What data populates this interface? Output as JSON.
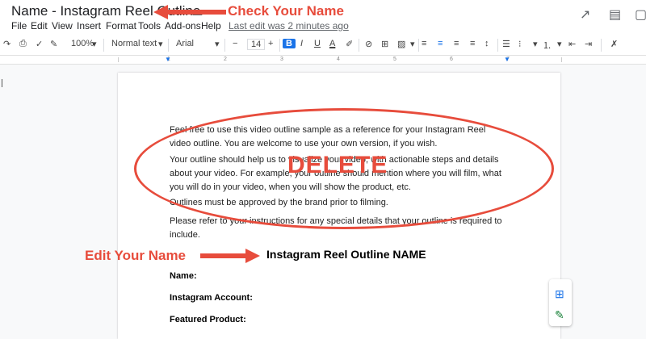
{
  "window": {
    "doc_title": "Name - Instagram Reel Outline",
    "last_edit": "Last edit was 2 minutes ago"
  },
  "menu": [
    "File",
    "Edit",
    "View",
    "Insert",
    "Format",
    "Tools",
    "Add-ons",
    "Help"
  ],
  "toolbar": {
    "zoom": "100%",
    "style": "Normal text",
    "font": "Arial",
    "font_size": "14"
  },
  "ruler": [
    "1",
    "2",
    "3",
    "4",
    "5",
    "6",
    "7"
  ],
  "document": {
    "paragraphs": [
      "Feel free to use this video outline sample as a reference for your Instagram Reel video outline. You are welcome to use your own version, if you wish.",
      "Your outline should help us to visualize your video, with actionable steps and details about your video. For example, your outline should mention where you will film, what you will do in your video, when you will show the product, etc.",
      "Outlines must be approved by the brand prior to filming.",
      "Please refer to your instructions for any special details that your outline is required to include."
    ],
    "heading": "Instagram Reel Outline NAME",
    "fields": [
      "Name:",
      "Instagram Account:",
      "Featured Product:"
    ]
  },
  "annotations": {
    "check_name": "Check Your Name",
    "delete": "DELETE",
    "edit_name": "Edit Your Name",
    "color": "#e74c3c"
  }
}
